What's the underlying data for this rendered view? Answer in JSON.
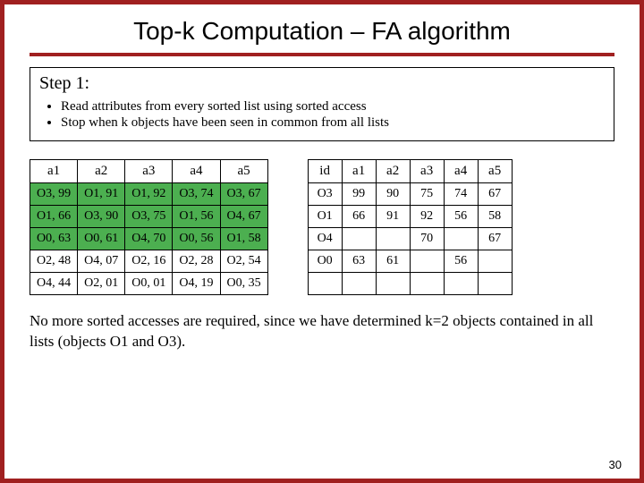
{
  "title": "Top-k Computation – FA algorithm",
  "step": {
    "heading": "Step 1:",
    "bullets": [
      "Read attributes from every sorted list using sorted access",
      "Stop when k objects have been seen in common from all lists"
    ]
  },
  "leftTable": {
    "headers": [
      "a1",
      "a2",
      "a3",
      "a4",
      "a5"
    ],
    "rows": [
      {
        "cells": [
          "O3, 99",
          "O1, 91",
          "O1, 92",
          "O3, 74",
          "O3, 67"
        ],
        "hl": true
      },
      {
        "cells": [
          "O1, 66",
          "O3, 90",
          "O3, 75",
          "O1, 56",
          "O4, 67"
        ],
        "hl": true
      },
      {
        "cells": [
          "O0, 63",
          "O0, 61",
          "O4, 70",
          "O0, 56",
          "O1, 58"
        ],
        "hl": true
      },
      {
        "cells": [
          "O2, 48",
          "O4, 07",
          "O2, 16",
          "O2, 28",
          "O2, 54"
        ],
        "hl": false
      },
      {
        "cells": [
          "O4, 44",
          "O2, 01",
          "O0, 01",
          "O4, 19",
          "O0, 35"
        ],
        "hl": false
      }
    ]
  },
  "rightTable": {
    "headers": [
      "id",
      "a1",
      "a2",
      "a3",
      "a4",
      "a5"
    ],
    "rows": [
      {
        "cells": [
          "O3",
          "99",
          "90",
          "75",
          "74",
          "67"
        ]
      },
      {
        "cells": [
          "O1",
          "66",
          "91",
          "92",
          "56",
          "58"
        ]
      },
      {
        "cells": [
          "O4",
          "",
          "",
          "70",
          "",
          "67"
        ]
      },
      {
        "cells": [
          "O0",
          "63",
          "61",
          "",
          "56",
          ""
        ]
      },
      {
        "cells": [
          "",
          "",
          "",
          "",
          "",
          ""
        ]
      }
    ]
  },
  "conclusion": "No more sorted accesses are required, since we have determined k=2 objects contained in all lists (objects O1 and O3).",
  "pageNumber": "30"
}
